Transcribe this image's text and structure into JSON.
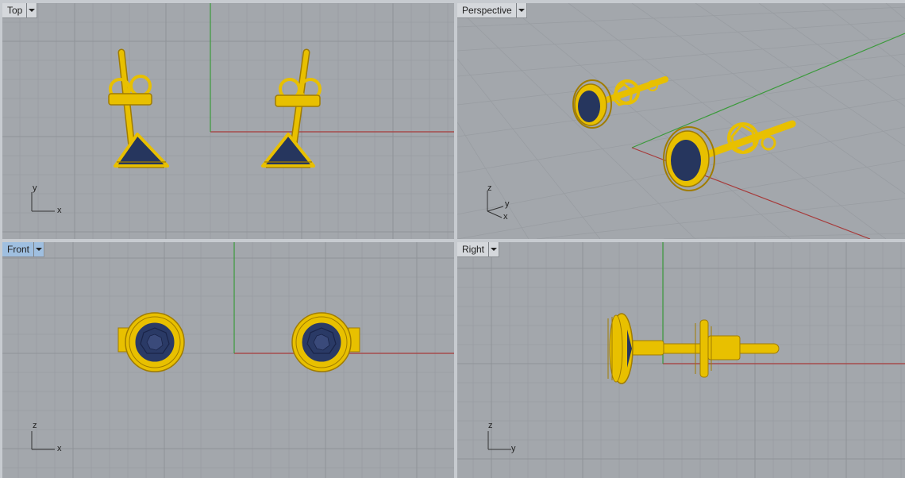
{
  "viewports": {
    "top": {
      "label": "Top",
      "axis_h": "x",
      "axis_v": "y"
    },
    "perspective": {
      "label": "Perspective",
      "axis_z": "z",
      "axis_y": "y",
      "axis_x": "x"
    },
    "front": {
      "label": "Front",
      "axis_h": "x",
      "axis_v": "z"
    },
    "right": {
      "label": "Right",
      "axis_h": "y",
      "axis_v": "z"
    }
  },
  "active_viewport": "Front",
  "colors": {
    "background": "#a3a7ac",
    "grid_minor": "#9a9ea3",
    "grid_major": "#8d9196",
    "x_axis": "#a63a3a",
    "y_axis": "#3a9a3a",
    "gold": "#e8c000",
    "gold_dark": "#a07c00",
    "sapphire": "#26365e",
    "tab_active": "#9fbfe0"
  },
  "icons": {
    "viewport_menu": "dropdown-arrow-icon"
  }
}
